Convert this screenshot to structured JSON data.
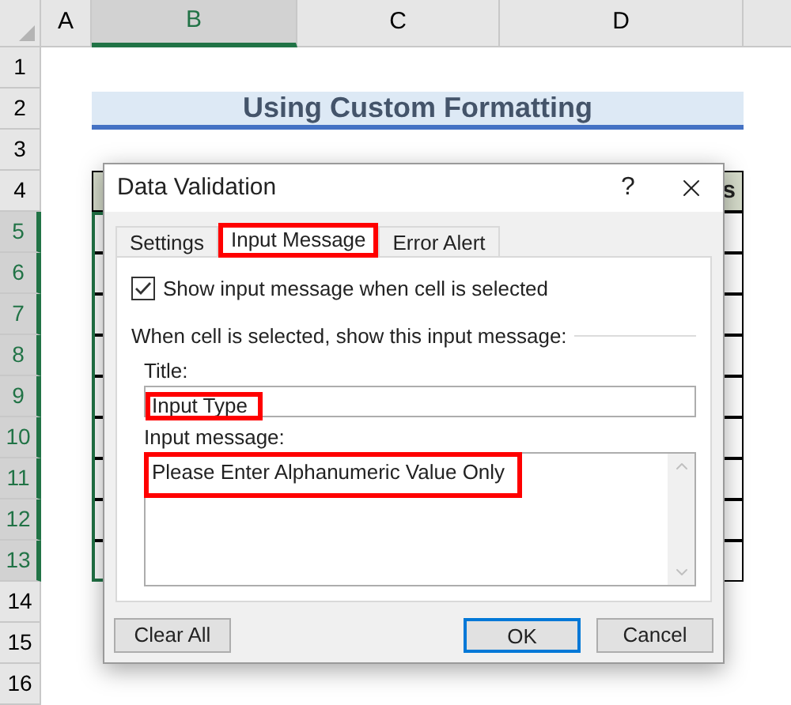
{
  "sheet": {
    "columns": [
      {
        "label": "A",
        "selected": false
      },
      {
        "label": "B",
        "selected": true
      },
      {
        "label": "C",
        "selected": false
      },
      {
        "label": "D",
        "selected": false
      }
    ],
    "rows": [
      {
        "label": "1",
        "selected": false
      },
      {
        "label": "2",
        "selected": false
      },
      {
        "label": "3",
        "selected": false
      },
      {
        "label": "4",
        "selected": false
      },
      {
        "label": "5",
        "selected": true
      },
      {
        "label": "6",
        "selected": true
      },
      {
        "label": "7",
        "selected": true
      },
      {
        "label": "8",
        "selected": true
      },
      {
        "label": "9",
        "selected": true
      },
      {
        "label": "10",
        "selected": true
      },
      {
        "label": "11",
        "selected": true
      },
      {
        "label": "12",
        "selected": true
      },
      {
        "label": "13",
        "selected": true
      },
      {
        "label": "14",
        "selected": false
      },
      {
        "label": "15",
        "selected": false
      },
      {
        "label": "16",
        "selected": false
      }
    ],
    "banner": {
      "text": "Using Custom Formatting"
    },
    "table_header_fragment": "s"
  },
  "dialog": {
    "title": "Data Validation",
    "help": "?",
    "tabs": [
      {
        "label": "Settings",
        "selected": false,
        "highlighted": false
      },
      {
        "label": "Input Message",
        "selected": true,
        "highlighted": true
      },
      {
        "label": "Error Alert",
        "selected": false,
        "highlighted": false
      }
    ],
    "show_message": {
      "label": "Show input message when cell is selected",
      "checked": true
    },
    "group_label": "When cell is selected, show this input message:",
    "title_field": {
      "label": "Title:",
      "value": "Input Type",
      "highlighted": true
    },
    "message_field": {
      "label": "Input message:",
      "value": "Please Enter Alphanumeric Value Only",
      "highlighted": true
    },
    "buttons": [
      {
        "label": "Clear All",
        "focused": false
      },
      {
        "label": "OK",
        "focused": true
      },
      {
        "label": "Cancel",
        "focused": false
      }
    ]
  }
}
